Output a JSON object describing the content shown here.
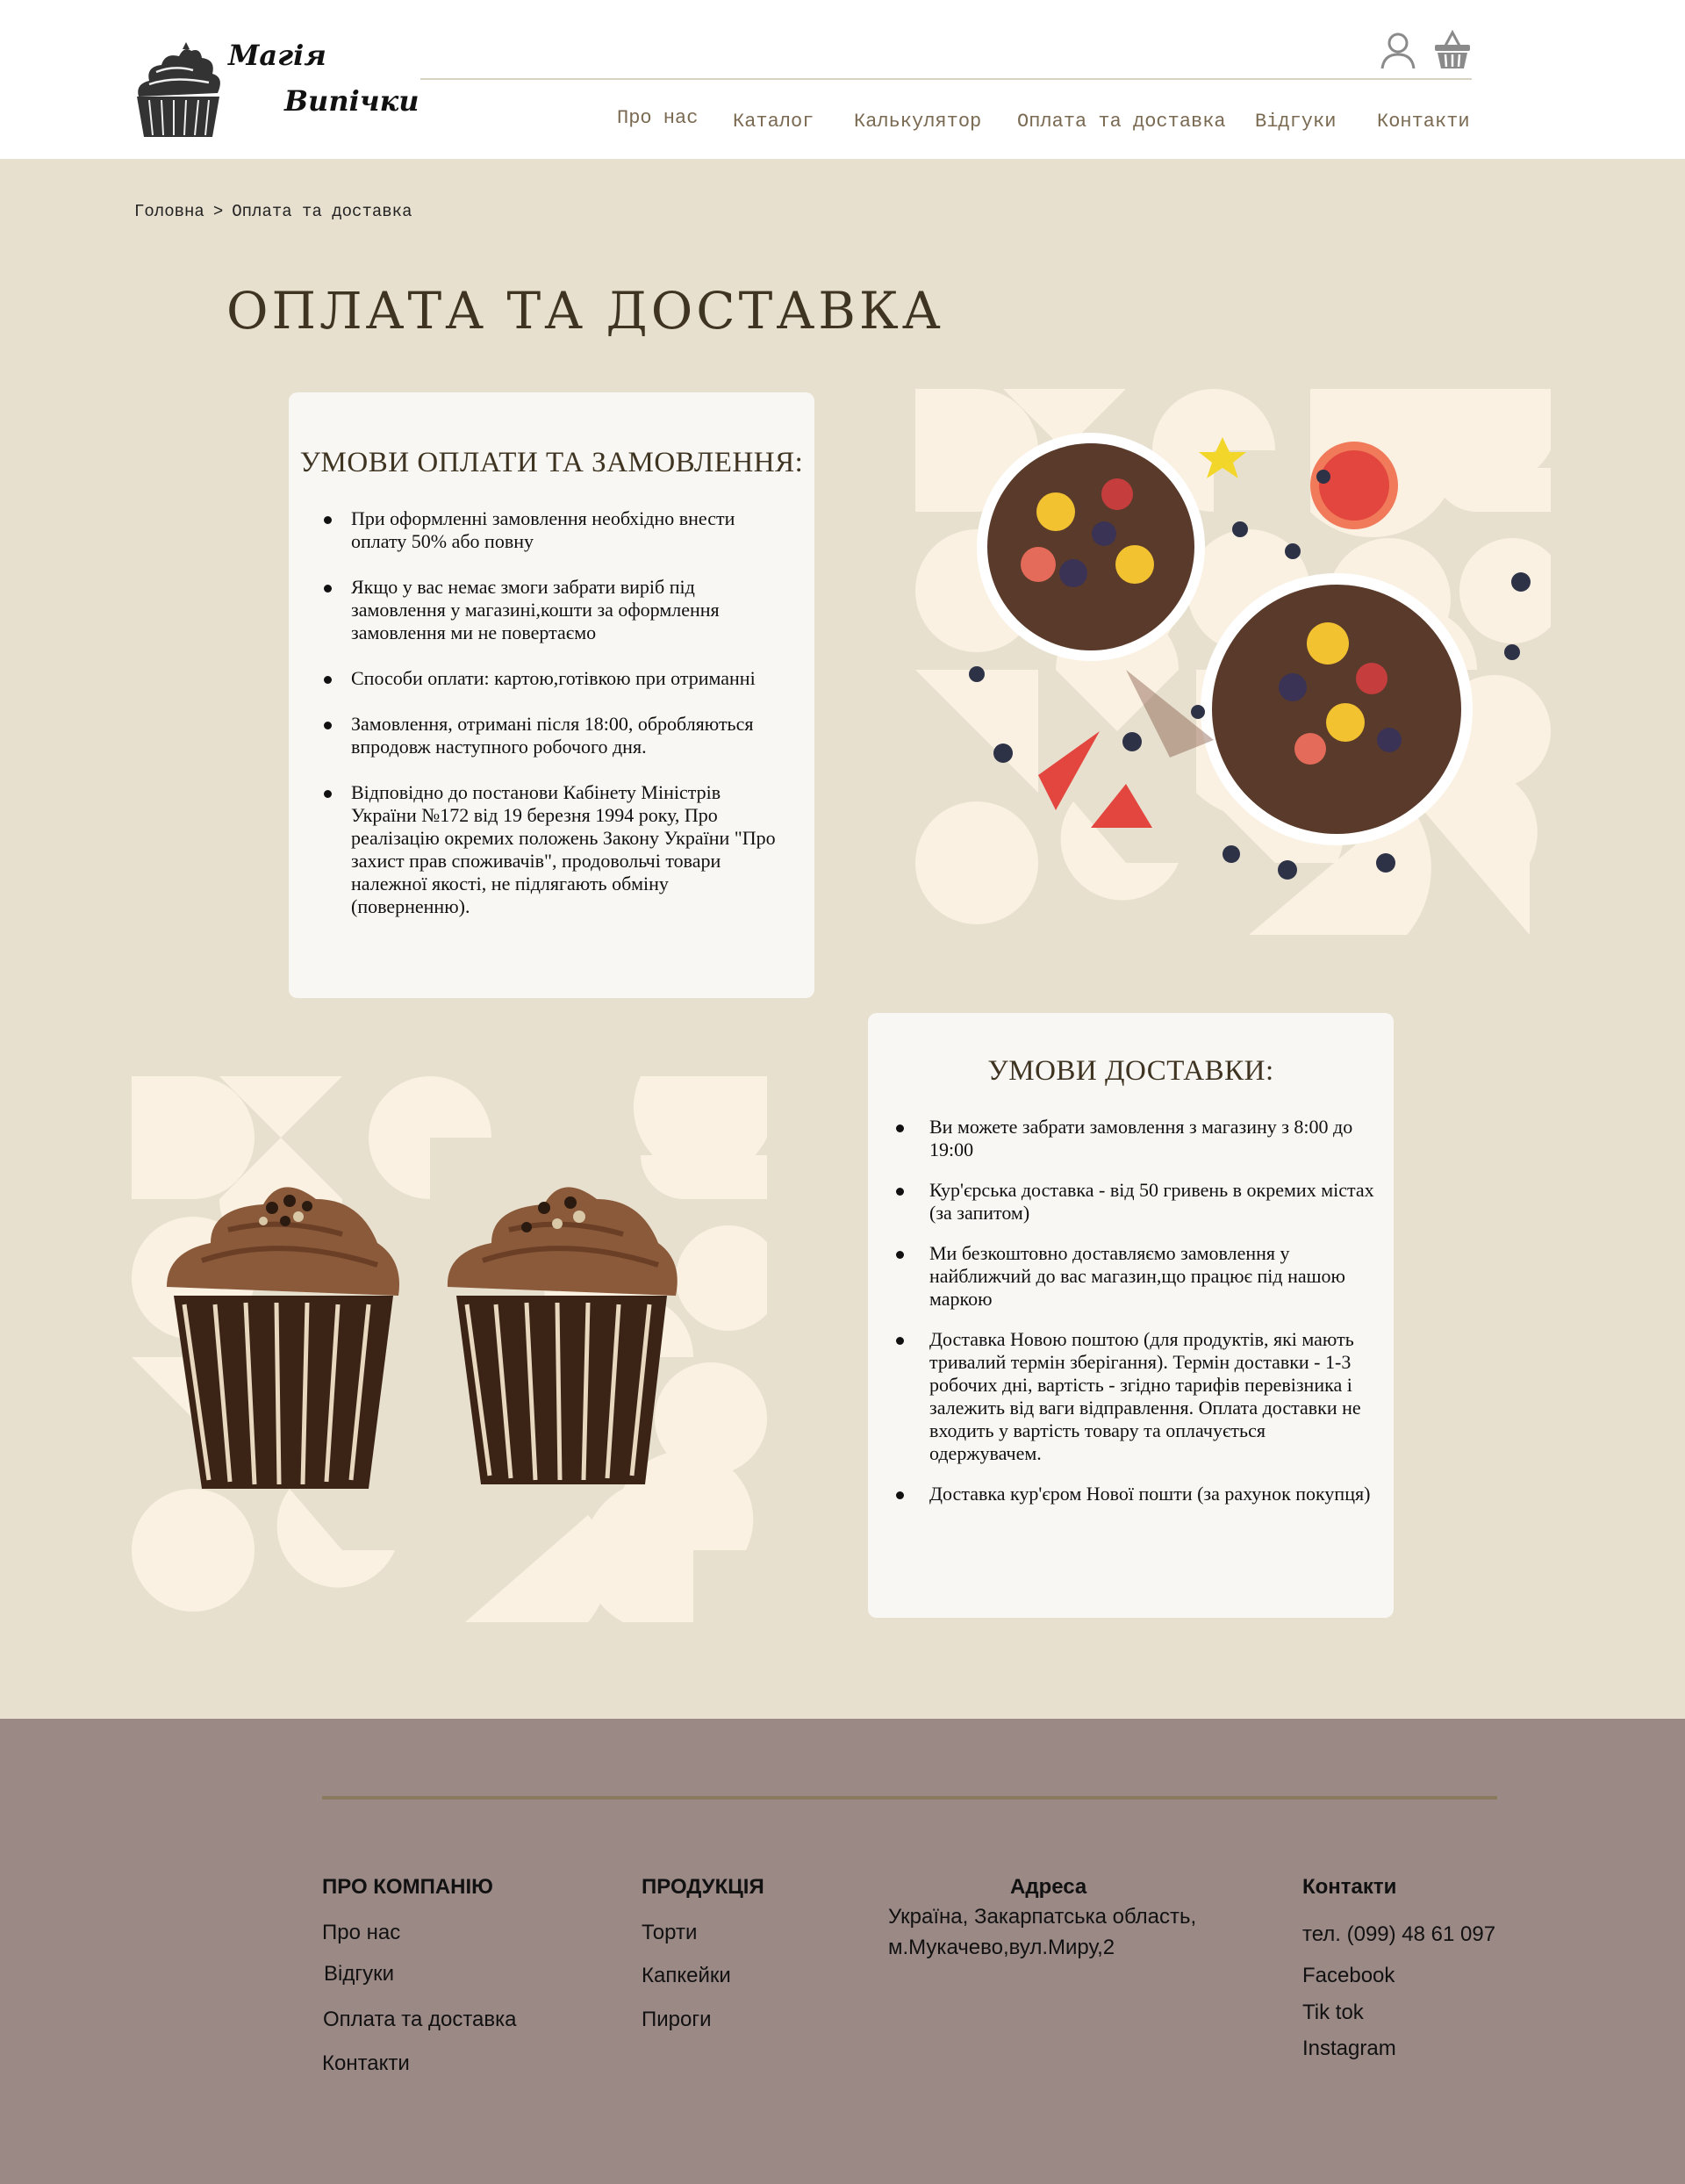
{
  "colors": {
    "page_bg": "#e8e0cf",
    "card_bg": "#f8f7f4",
    "footer_bg": "#9b8986",
    "title": "#3f3421",
    "nav_text": "#7a6a52",
    "accent_shape": "#faf1e2"
  },
  "header": {
    "logo": {
      "line1": "Магія",
      "line2": "Випічки",
      "icon": "cupcake-logo-icon"
    },
    "icons": {
      "user": "user-icon",
      "basket": "basket-icon"
    },
    "nav": [
      "Про нас",
      "Каталог",
      "Калькулятор",
      "Оплата та доставка",
      "Відгуки",
      "Контакти"
    ]
  },
  "breadcrumb": {
    "home": "Головна",
    "separator": ">",
    "current": "Оплата та доставка"
  },
  "page_title": "ОПЛАТА ТА ДОСТАВКА",
  "payment": {
    "title": "УМОВИ ОПЛАТИ ТА ЗАМОВЛЕННЯ:",
    "items": [
      "При оформленні замовлення необхідно внести оплату 50% або повну",
      "Якщо у вас немає змоги забрати виріб під замовлення у магазині,кошти за оформлення замовлення ми не повертаємо",
      "Способи оплати: картою,готівкою при отриманні",
      "Замовлення, отримані після 18:00, обробляються впродовж наступного робочого дня.",
      "Відповідно до постанови Кабінету Міністрів України №172 від 19 березня 1994 року, Про реалізацію окремих положень Закону України \"Про захист прав споживачів\", продовольчі товари належної якості, не підлягають обміну (поверненню)."
    ]
  },
  "delivery": {
    "title": "УМОВИ ДОСТАВКИ:",
    "items": [
      "Ви можете забрати замовлення з магазину з 8:00 до 19:00",
      "Кур'єрська доставка - від 50 гривень в окремих містах (за запитом)",
      "Ми безкоштовно доставляємо замовлення у найближчий до вас магазин,що працює під нашою маркою",
      "Доставка Новою поштою (для продуктів, які мають тривалий термін зберігання). Термін доставки - 1-3 робочих дні, вартість - згідно тарифів перевізника і залежить від ваги відправлення. Оплата доставки не входить у вартість товару та оплачується одержувачем.",
      "Доставка кур'єром Нової пошти (за рахунок покупця)"
    ]
  },
  "images": {
    "bowls": "smoothie-bowls-image",
    "cupcakes": "chocolate-cupcakes-image"
  },
  "footer": {
    "company": {
      "heading": "ПРО КОМПАНІЮ",
      "links": [
        "Про нас",
        "Відгуки",
        "Оплата та доставка",
        "Контакти"
      ]
    },
    "products": {
      "heading": "ПРОДУКЦІЯ",
      "links": [
        "Торти",
        "Капкейки",
        "Пироги"
      ]
    },
    "address": {
      "heading": "Адреса",
      "line1": "Україна, Закарпатська область,",
      "line2": "м.Мукачево,вул.Миру,2"
    },
    "contacts": {
      "heading": "Контакти",
      "phone": "тел. (099) 48 61 097",
      "links": [
        "Facebook",
        "Tik tok",
        "Instagram"
      ]
    }
  }
}
